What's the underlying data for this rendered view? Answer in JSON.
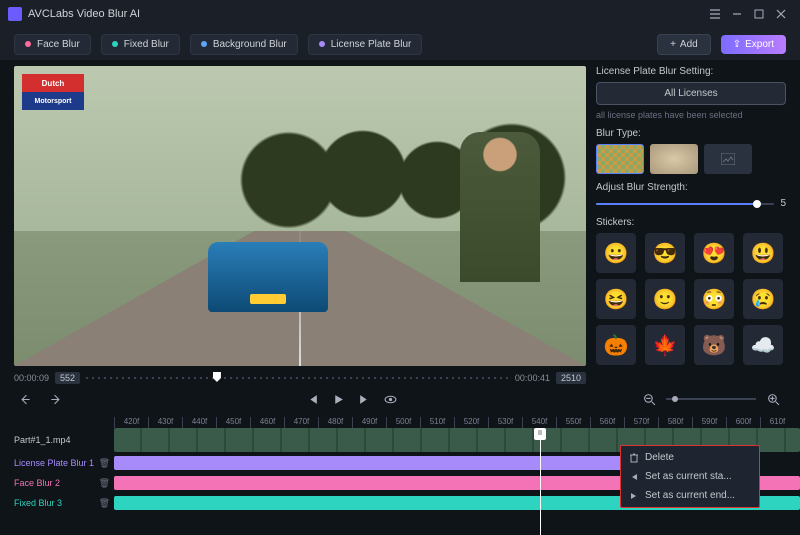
{
  "app": {
    "title": "AVCLabs Video Blur AI"
  },
  "toolbar": {
    "face": "Face Blur",
    "fixed": "Fixed Blur",
    "background": "Background Blur",
    "license": "License Plate Blur",
    "add": "Add",
    "export": "Export"
  },
  "video": {
    "logo_top": "Dutch",
    "logo_bot": "Motorsport",
    "time_start": "00:00:09",
    "frame_start": "552",
    "time_end": "00:00:41",
    "frame_end": "2510"
  },
  "panel": {
    "setting_label": "License Plate Blur Setting:",
    "all_licenses": "All Licenses",
    "hint": "all license plates have been selected",
    "blur_type": "Blur Type:",
    "strength_label": "Adjust Blur Strength:",
    "strength_value": "5",
    "stickers_label": "Stickers:",
    "stickers": [
      "😀",
      "😎",
      "😍",
      "😃",
      "😆",
      "🙂",
      "😳",
      "😢",
      "🎃",
      "🍁",
      "🐻",
      "☁️"
    ]
  },
  "ruler": [
    "420f",
    "430f",
    "440f",
    "450f",
    "460f",
    "470f",
    "480f",
    "490f",
    "500f",
    "510f",
    "520f",
    "530f",
    "540f",
    "550f",
    "560f",
    "570f",
    "580f",
    "590f",
    "600f",
    "610f"
  ],
  "tracks": {
    "file": "Part#1_1.mp4",
    "t1": "License Plate Blur 1",
    "t2": "Face Blur 2",
    "t3": "Fixed Blur 3"
  },
  "ctx": {
    "delete": "Delete",
    "start": "Set as current sta...",
    "end": "Set as current end..."
  }
}
